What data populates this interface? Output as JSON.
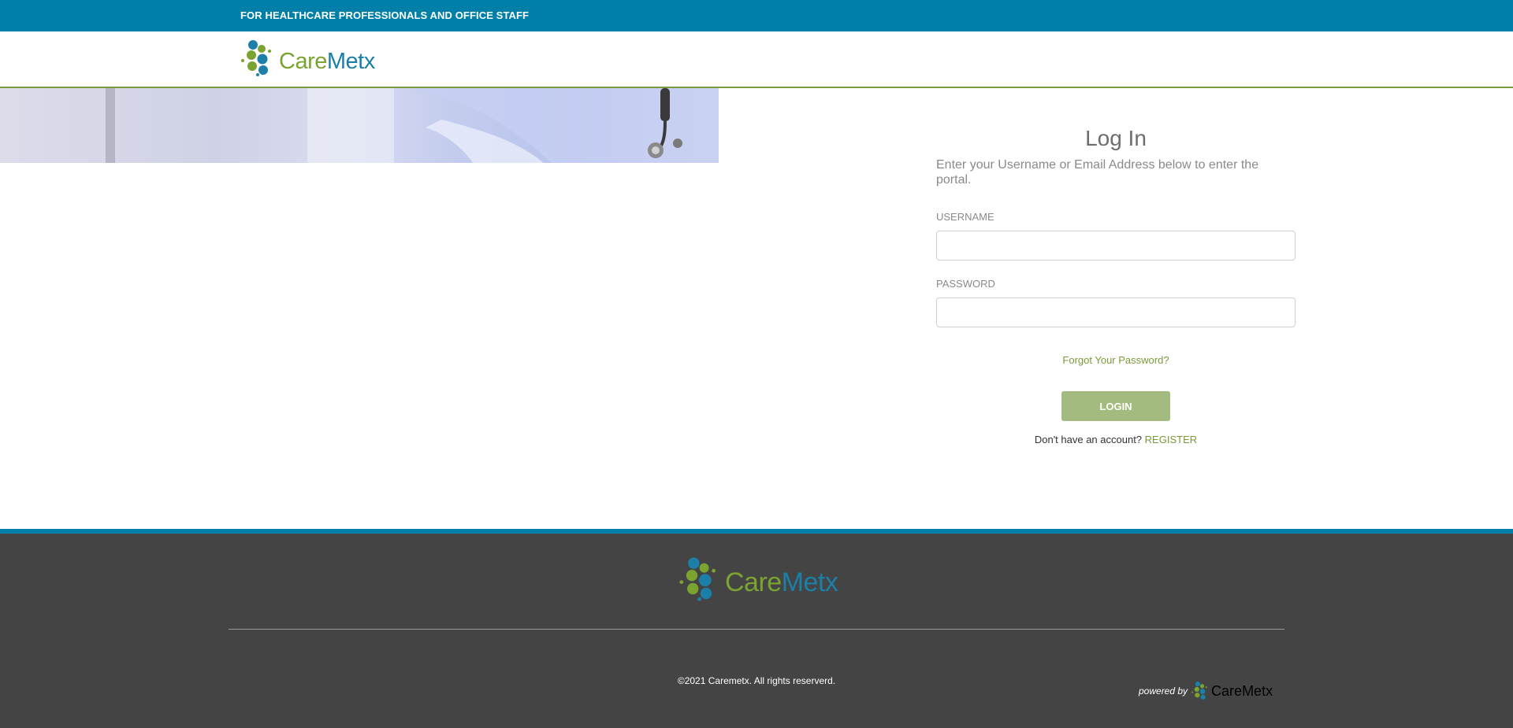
{
  "topbar": {
    "text": "FOR HEALTHCARE PROFESSIONALS AND OFFICE STAFF"
  },
  "brand": {
    "care": "Care",
    "metx": "Metx",
    "care_color": "#7aa32f",
    "metx_color": "#1b7fa8"
  },
  "colors": {
    "topbar": "#0080a8",
    "accent_green": "#7a9a3a",
    "login_button": "#a4bb7f",
    "footer": "#444444"
  },
  "login": {
    "title": "Log In",
    "subtitle": "Enter your Username or Email Address below to enter the portal.",
    "username_label": "USERNAME",
    "username_value": "",
    "password_label": "PASSWORD",
    "password_value": "",
    "forgot": "Forgot Your Password?",
    "button": "LOGIN",
    "no_account": "Don't have an account?",
    "register": "REGISTER"
  },
  "footer": {
    "copyright": "©2021 Caremetx. All rights reserverd.",
    "powered_by": "powered by"
  }
}
